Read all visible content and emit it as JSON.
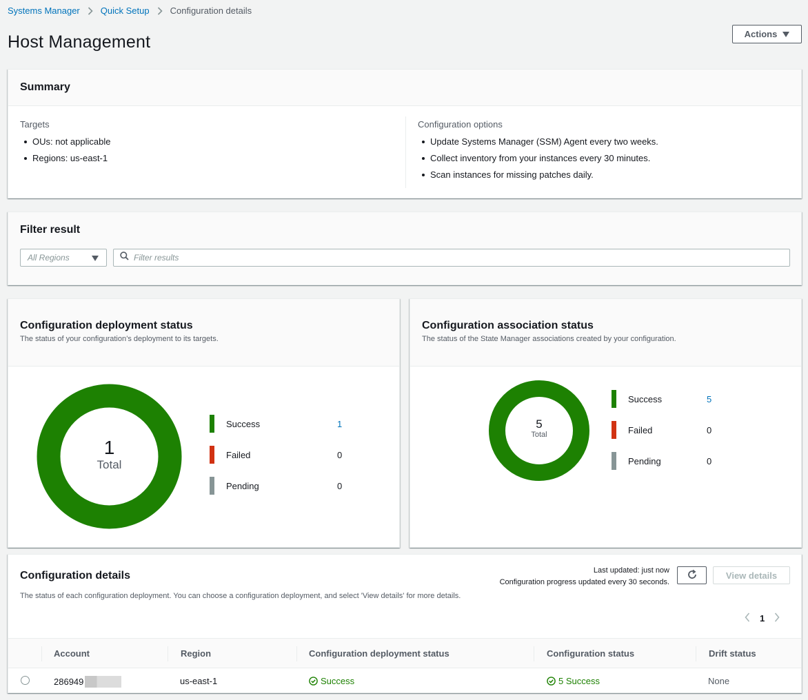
{
  "breadcrumb": {
    "items": [
      {
        "label": "Systems Manager"
      },
      {
        "label": "Quick Setup"
      },
      {
        "label": "Configuration details"
      }
    ]
  },
  "page": {
    "title": "Host Management",
    "actions_label": "Actions"
  },
  "summary": {
    "title": "Summary",
    "targets": {
      "label": "Targets",
      "items": [
        "OUs: not applicable",
        "Regions: us-east-1"
      ]
    },
    "options": {
      "label": "Configuration options",
      "items": [
        "Update Systems Manager (SSM) Agent every two weeks.",
        "Collect inventory from your instances every 30 minutes.",
        "Scan instances for missing patches daily."
      ]
    }
  },
  "filter": {
    "title": "Filter result",
    "region_value": "All Regions",
    "search_placeholder": "Filter results"
  },
  "colors": {
    "success": "#1d8102",
    "failed": "#d13212",
    "pending": "#879596",
    "link": "#0073bb"
  },
  "deployment_status": {
    "title": "Configuration deployment status",
    "description": "The status of your configuration’s deployment to its targets.",
    "total": "1",
    "total_label": "Total",
    "legend": [
      {
        "label": "Success",
        "value": "1"
      },
      {
        "label": "Failed",
        "value": "0"
      },
      {
        "label": "Pending",
        "value": "0"
      }
    ]
  },
  "association_status": {
    "title": "Configuration association status",
    "description": "The status of the State Manager associations created by your configuration.",
    "total": "5",
    "total_label": "Total",
    "legend": [
      {
        "label": "Success",
        "value": "5"
      },
      {
        "label": "Failed",
        "value": "0"
      },
      {
        "label": "Pending",
        "value": "0"
      }
    ]
  },
  "details": {
    "title": "Configuration details",
    "description": "The status of each configuration deployment. You can choose a configuration deployment, and select 'View details' for more details.",
    "last_updated": "Last updated: just now",
    "progress_note": "Configuration progress updated every 30 seconds.",
    "view_details_label": "View details",
    "page_number": "1",
    "columns": [
      "Account",
      "Region",
      "Configuration deployment status",
      "Configuration status",
      "Drift status"
    ],
    "rows": [
      {
        "account": "286949",
        "region": "us-east-1",
        "deployment_status": "Success",
        "config_status": "5 Success",
        "drift_status": "None"
      }
    ]
  }
}
